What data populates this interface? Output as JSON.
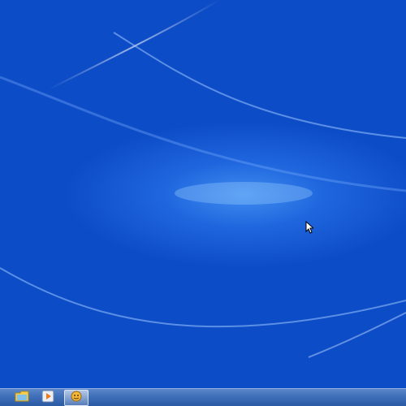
{
  "desktop": {
    "wallpaper": "blue-light-streaks",
    "accent_color": "#0d4cc7"
  },
  "taskbar": {
    "pinned": [
      {
        "name": "file-explorer",
        "icon": "folder-icon",
        "active": false
      },
      {
        "name": "media-player",
        "icon": "play-icon",
        "active": false
      },
      {
        "name": "messenger",
        "icon": "messenger-icon",
        "active": true
      }
    ]
  },
  "cursor": {
    "type": "arrow"
  }
}
